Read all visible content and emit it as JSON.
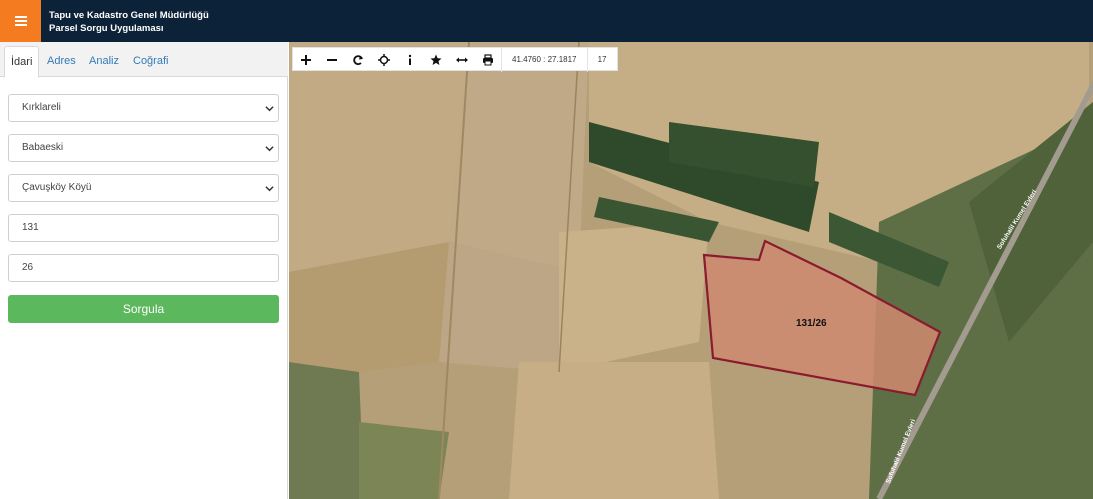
{
  "header": {
    "title_line1": "Tapu ve Kadastro Genel Müdürlüğü",
    "title_line2": "Parsel Sorgu Uygulaması",
    "menu_icon": "hamburger-icon",
    "accent": "#f47b20",
    "bar_color": "#0c2238"
  },
  "tabs": [
    {
      "label": "İdari",
      "active": true
    },
    {
      "label": "Adres"
    },
    {
      "label": "Analiz"
    },
    {
      "label": "Coğrafi"
    }
  ],
  "form": {
    "province": "Kırklareli",
    "district": "Babaeski",
    "neighborhood": "Çavuşköy Köyü",
    "block": "131",
    "parcel": "26",
    "submit_label": "Sorgula",
    "submit_color": "#5cb85c"
  },
  "map": {
    "toolbar_icons": [
      "zoom-in-icon",
      "zoom-out-icon",
      "refresh-icon",
      "locate-icon",
      "info-icon",
      "star-icon",
      "measure-icon",
      "print-icon"
    ],
    "coordinates": "41.4760 : 27.1817",
    "zoom_level": "17",
    "parcel_label": "131/26",
    "road_label_1": "Sofuhalil Kumel Evleri",
    "road_label_2": "Sofuhalil Kumel Evleri",
    "parcel_outline_color": "#8a1b2e"
  }
}
